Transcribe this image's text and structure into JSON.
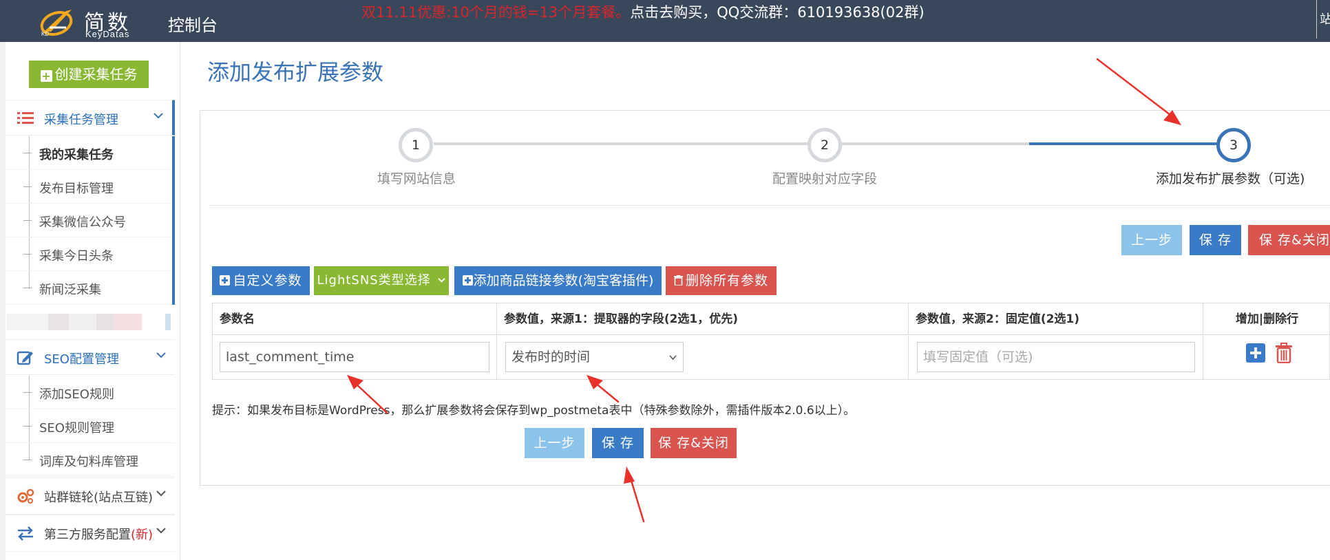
{
  "header": {
    "logo_cn": "简数",
    "logo_en": "KeyDatas",
    "title": "控制台",
    "promo_red": "双11.11优惠:10个月的钱=13个月套餐。",
    "promo_white": "点击去购买，QQ交流群：610193638(02群)",
    "edge_char": "站"
  },
  "sidebar": {
    "create_label": "创建采集任务",
    "section1": {
      "label": "采集任务管理",
      "items": [
        "我的采集任务",
        "发布目标管理",
        "采集微信公众号",
        "采集今日头条",
        "新闻泛采集"
      ]
    },
    "section2": {
      "label": "SEO配置管理",
      "items": [
        "添加SEO规则",
        "SEO规则管理",
        "词库及句料库管理"
      ]
    },
    "section3": {
      "label": "站群链轮(站点互链)"
    },
    "section4": {
      "label": "第三方服务配置",
      "badge": "(新)"
    }
  },
  "main": {
    "page_title": "添加发布扩展参数",
    "steps": [
      {
        "num": "1",
        "label": "填写网站信息"
      },
      {
        "num": "2",
        "label": "配置映射对应字段"
      },
      {
        "num": "3",
        "label": "添加发布扩展参数（可选)"
      }
    ],
    "buttons": {
      "prev": "上一步",
      "save": "保 存",
      "save_close": "保 存&关闭"
    },
    "toolbar": {
      "custom": "自定义参数",
      "lightsns": "LightSNS类型选择",
      "taobao": "添加商品链接参数(淘宝客插件)",
      "delete_all": "删除所有参数"
    },
    "table": {
      "headers": [
        "参数名",
        "参数值，来源1：提取器的字段(2选1，优先)",
        "参数值，来源2：固定值(2选1)",
        "增加|删除行"
      ],
      "row": {
        "param_name": "last_comment_time",
        "source1_selected": "发布时的时间",
        "source2_placeholder": "填写固定值（可选)"
      }
    },
    "hint": "提示：如果发布目标是WordPress，那么扩展参数将会保存到wp_postmeta表中（特殊参数除外，需插件版本2.0.6以上）。"
  },
  "colors": {
    "topbar": "#39475a",
    "primary": "#3a7bc8",
    "green": "#8ab833",
    "red": "#d9534f",
    "light_blue": "#8cc3ea",
    "annotation": "#e8312a"
  }
}
